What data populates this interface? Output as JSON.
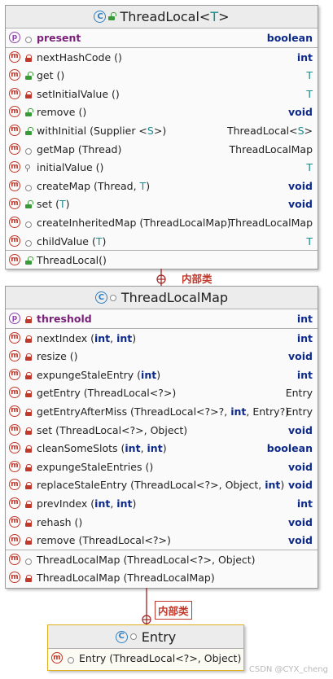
{
  "classes": [
    {
      "title": "ThreadLocal",
      "type_param": "T",
      "header_icons": [
        "class-icon",
        "green-open-lock-icon"
      ],
      "sections": [
        [
          {
            "icon": "p",
            "vis": "dot",
            "name": "present",
            "type": "boolean",
            "style": "field"
          }
        ],
        [
          {
            "icon": "m",
            "vis": "lock-red",
            "name": "nextHashCode ()",
            "type": "int"
          },
          {
            "icon": "m",
            "vis": "lock-green-open",
            "name": "get ()",
            "type": "T"
          },
          {
            "icon": "m",
            "vis": "lock-red",
            "name": "setInitialValue ()",
            "type": "T"
          },
          {
            "icon": "m",
            "vis": "lock-green-open",
            "name": "remove ()",
            "type": "void"
          },
          {
            "icon": "m",
            "vis": "lock-green-open",
            "name": "withInitial (Supplier <S>)",
            "type": "ThreadLocal<S>"
          },
          {
            "icon": "m",
            "vis": "dot",
            "name": "getMap (Thread)",
            "type": "ThreadLocalMap"
          },
          {
            "icon": "m",
            "vis": "key",
            "name": "initialValue ()",
            "type": "T"
          },
          {
            "icon": "m",
            "vis": "dot",
            "name": "createMap (Thread, T)",
            "type": "void"
          },
          {
            "icon": "m",
            "vis": "lock-green-open",
            "name": "set (T)",
            "type": "void"
          },
          {
            "icon": "m",
            "vis": "dot",
            "name": "createInheritedMap (ThreadLocalMap)",
            "type": "ThreadLocalMap"
          },
          {
            "icon": "m",
            "vis": "dot",
            "name": "childValue (T)",
            "type": "T"
          }
        ],
        [
          {
            "icon": "m",
            "vis": "lock-green-open",
            "name": "ThreadLocal()",
            "type": ""
          }
        ]
      ]
    },
    {
      "title": "ThreadLocalMap",
      "type_param": "",
      "header_icons": [
        "class-icon",
        "dot-icon"
      ],
      "sections": [
        [
          {
            "icon": "p",
            "vis": "lock-red",
            "name": "threshold",
            "type": "int",
            "style": "field"
          }
        ],
        [
          {
            "icon": "m",
            "vis": "lock-red",
            "name": "nextIndex (int, int)",
            "type": "int"
          },
          {
            "icon": "m",
            "vis": "lock-red",
            "name": "resize ()",
            "type": "void"
          },
          {
            "icon": "m",
            "vis": "lock-red",
            "name": "expungeStaleEntry (int)",
            "type": "int"
          },
          {
            "icon": "m",
            "vis": "lock-red",
            "name": "getEntry (ThreadLocal<?>)",
            "type": "Entry"
          },
          {
            "icon": "m",
            "vis": "lock-red",
            "name": "getEntryAfterMiss (ThreadLocal<?>?, int, Entry?)",
            "type": "Entry"
          },
          {
            "icon": "m",
            "vis": "lock-red",
            "name": "set (ThreadLocal<?>, Object)",
            "type": "void"
          },
          {
            "icon": "m",
            "vis": "lock-red",
            "name": "cleanSomeSlots (int, int)",
            "type": "boolean"
          },
          {
            "icon": "m",
            "vis": "lock-red",
            "name": "expungeStaleEntries ()",
            "type": "void"
          },
          {
            "icon": "m",
            "vis": "lock-red",
            "name": "replaceStaleEntry (ThreadLocal<?>, Object, int)",
            "type": "void"
          },
          {
            "icon": "m",
            "vis": "lock-red",
            "name": "prevIndex (int, int)",
            "type": "int"
          },
          {
            "icon": "m",
            "vis": "lock-red",
            "name": "rehash ()",
            "type": "void"
          },
          {
            "icon": "m",
            "vis": "lock-red",
            "name": "remove (ThreadLocal<?>)",
            "type": "void"
          }
        ],
        [
          {
            "icon": "m",
            "vis": "dot",
            "name": "ThreadLocalMap (ThreadLocal<?>, Object)",
            "type": ""
          },
          {
            "icon": "m",
            "vis": "lock-red",
            "name": "ThreadLocalMap (ThreadLocalMap)",
            "type": ""
          }
        ]
      ]
    },
    {
      "title": "Entry",
      "type_param": "",
      "header_icons": [
        "class-icon",
        "dot-icon"
      ],
      "sections": [
        [
          {
            "icon": "m",
            "vis": "dot",
            "name": "Entry (ThreadLocal<?>, Object)",
            "type": ""
          }
        ]
      ]
    }
  ],
  "associations": [
    {
      "label": "内部类"
    },
    {
      "label": "内部类"
    }
  ],
  "watermark": "CSDN @CYX_cheng",
  "colors": {
    "keyword": "#0d2a8a",
    "type_param": "#1b8c8c",
    "method_icon": "#c0392b",
    "property_icon": "#8e44ad",
    "class_icon": "#2d7fc1",
    "selected_border": "#e0b020",
    "connector": "#a02020"
  }
}
